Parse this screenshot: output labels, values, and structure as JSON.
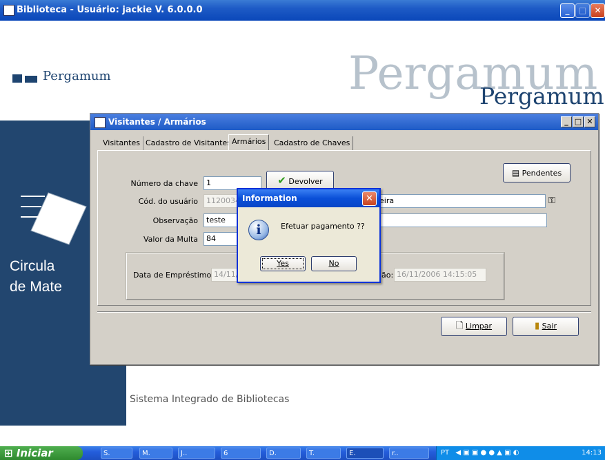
{
  "window": {
    "title": "Biblioteca - Usuário: jackie   V. 6.0.0.0"
  },
  "background": {
    "logo_text": "Pergamum",
    "big_text": "Pergamum",
    "big_text_2": "Pergamum",
    "left_text_line1": "Circula",
    "left_text_line2": "de Mate",
    "footer_text": "Sistema Integrado de Bibliotecas"
  },
  "dialog": {
    "title": "Visitantes / Armários",
    "tabs": [
      {
        "label": "Visitantes"
      },
      {
        "label": "Cadastro de Visitantes"
      },
      {
        "label": "Armários",
        "active": true
      },
      {
        "label": "Cadastro de Chaves"
      }
    ],
    "fields": {
      "numero_chave_label": "Número da chave",
      "numero_chave_value": "1",
      "cod_usuario_label": "Cód. do usuário",
      "cod_usuario_value": "1120034",
      "nome_usuario_value": "eira",
      "observacao_label": "Observação",
      "observacao_value": "teste",
      "valor_multa_label": "Valor da Multa",
      "valor_multa_value": "84",
      "data_emprestimo_label": "Data de Empréstimo:",
      "data_emprestimo_value": "14/11/",
      "data_devolucao_label": "ão:",
      "data_devolucao_value": "16/11/2006 14:15:05"
    },
    "buttons": {
      "devolver": "Devolver",
      "pendentes": "Pendentes",
      "limpar": "Limpar",
      "sair": "Sair"
    }
  },
  "message_box": {
    "title": "Information",
    "text": "Efetuar pagamento ??",
    "yes": "Yes",
    "no": "No"
  },
  "taskbar": {
    "start": "Iniciar",
    "items": [
      "S.",
      "M.",
      "J..",
      "6",
      "D.",
      "T.",
      "E.",
      "r.."
    ],
    "lang": "PT",
    "clock": "14:13"
  },
  "colors": {
    "title_blue": "#0a47b9",
    "dialog_bg": "#d4d0c8",
    "brand_navy": "#22466f"
  }
}
